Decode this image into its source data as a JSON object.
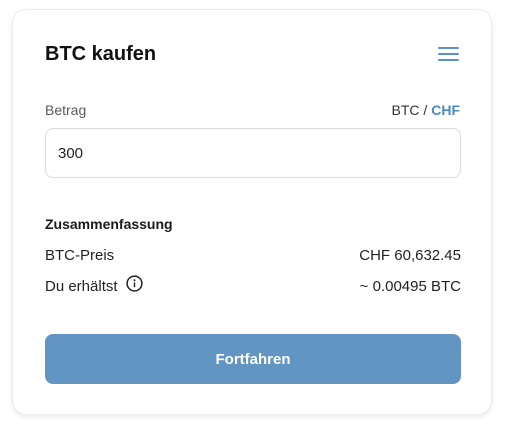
{
  "header": {
    "title": "BTC kaufen",
    "menu_icon": "hamburger-menu-icon"
  },
  "amount": {
    "label": "Betrag",
    "unit_inactive": "BTC",
    "unit_separator": " / ",
    "unit_active": "CHF",
    "value": "300"
  },
  "summary": {
    "heading": "Zusammenfassung",
    "price_label": "BTC-Preis",
    "price_value": "CHF 60,632.45",
    "receive_label": "Du erhältst",
    "receive_icon": "info-icon",
    "receive_value": "~ 0.00495 BTC"
  },
  "actions": {
    "continue_label": "Fortfahren"
  },
  "colors": {
    "accent": "#4a8ac2",
    "button": "#6295c2"
  }
}
